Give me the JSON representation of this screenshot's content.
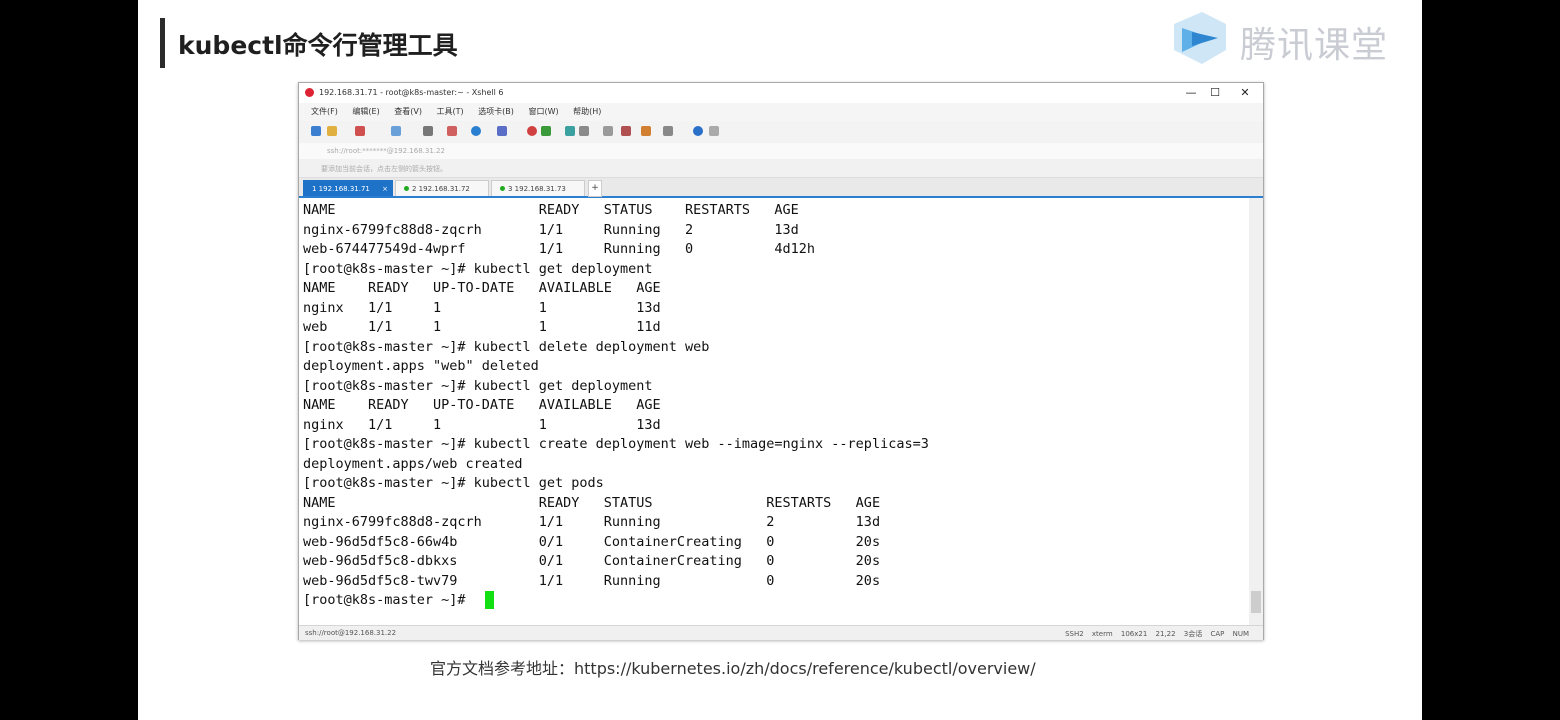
{
  "slide": {
    "title": "kubectl命令行管理工具",
    "logo_text": "腾讯课堂",
    "footer": "官方文档参考地址：https://kubernetes.io/zh/docs/reference/kubectl/overview/"
  },
  "window": {
    "title": "192.168.31.71 - root@k8s-master:~ - Xshell 6",
    "controls": {
      "minimize": "—",
      "maximize": "☐",
      "close": "✕"
    },
    "menu": [
      "文件(F)",
      "编辑(E)",
      "查看(V)",
      "工具(T)",
      "选项卡(B)",
      "窗口(W)",
      "帮助(H)"
    ],
    "address": "ssh://root:*******@192.168.31.22",
    "notice": "要添加当前会话，点击左侧的箭头按钮。",
    "tabs": [
      {
        "label": "1 192.168.31.71",
        "active": true
      },
      {
        "label": "2 192.168.31.72",
        "active": false
      },
      {
        "label": "3 192.168.31.73",
        "active": false
      }
    ],
    "tab_add": "+",
    "tab_close": "×",
    "terminal_lines": [
      "NAME                         READY   STATUS    RESTARTS   AGE",
      "nginx-6799fc88d8-zqcrh       1/1     Running   2          13d",
      "web-674477549d-4wprf         1/1     Running   0          4d12h",
      "[root@k8s-master ~]# kubectl get deployment",
      "NAME    READY   UP-TO-DATE   AVAILABLE   AGE",
      "nginx   1/1     1            1           13d",
      "web     1/1     1            1           11d",
      "[root@k8s-master ~]# kubectl delete deployment web",
      "deployment.apps \"web\" deleted",
      "[root@k8s-master ~]# kubectl get deployment",
      "NAME    READY   UP-TO-DATE   AVAILABLE   AGE",
      "nginx   1/1     1            1           13d",
      "[root@k8s-master ~]# kubectl create deployment web --image=nginx --replicas=3",
      "deployment.apps/web created",
      "[root@k8s-master ~]# kubectl get pods",
      "NAME                         READY   STATUS              RESTARTS   AGE",
      "nginx-6799fc88d8-zqcrh       1/1     Running             2          13d",
      "web-96d5df5c8-66w4b          0/1     ContainerCreating   0          20s",
      "web-96d5df5c8-dbkxs          0/1     ContainerCreating   0          20s",
      "web-96d5df5c8-twv79          1/1     Running             0          20s",
      "[root@k8s-master ~]# "
    ],
    "status_left": "ssh://root@192.168.31.22",
    "status_right": "SSH2 xterm 106x21 21,22 3会话 CAP NUM"
  }
}
